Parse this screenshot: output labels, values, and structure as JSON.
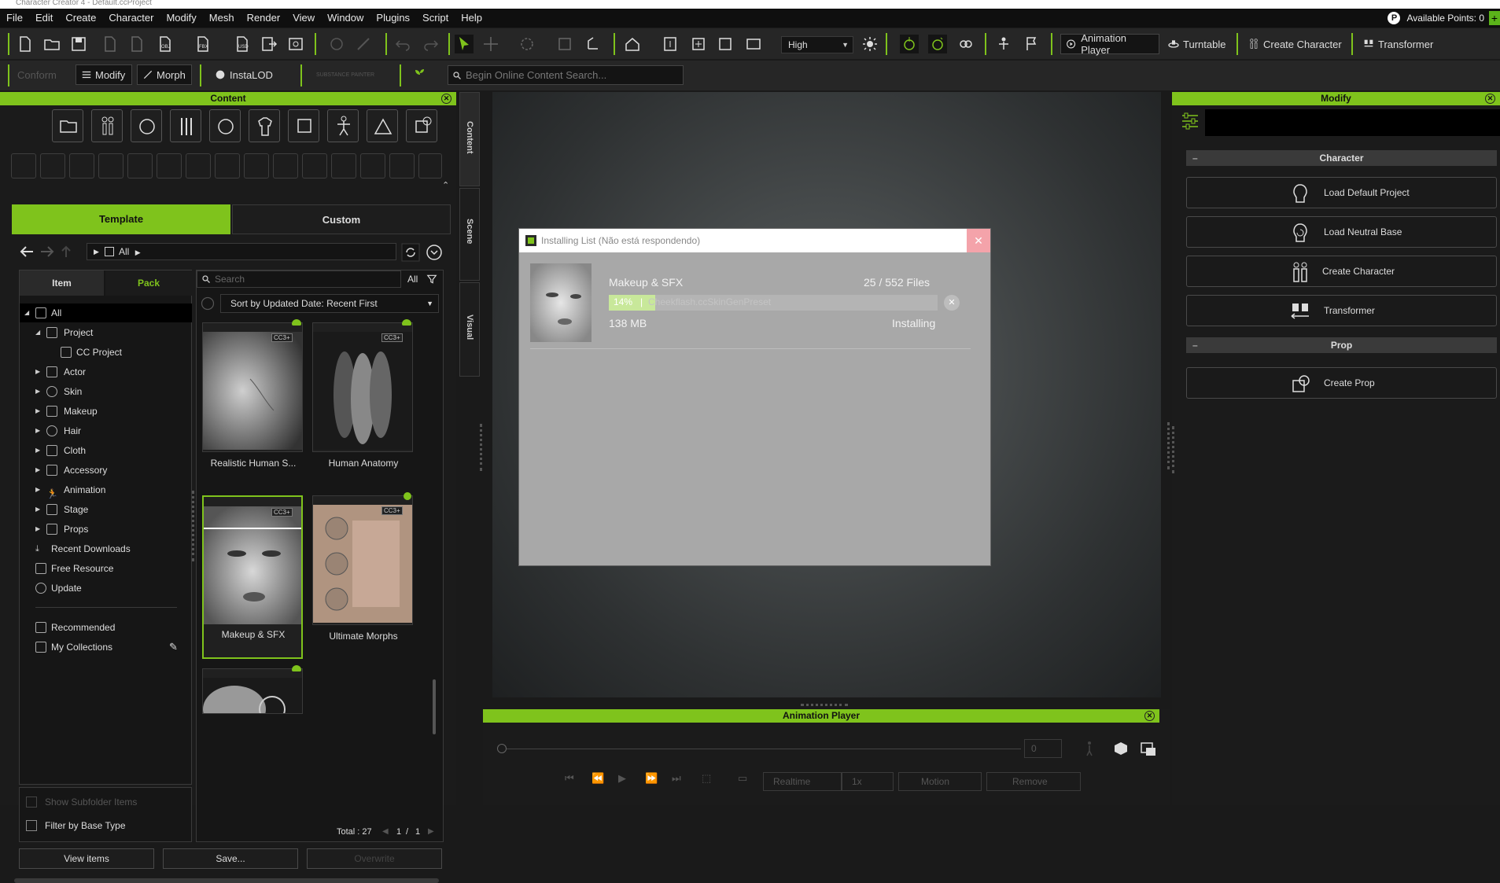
{
  "window": {
    "title": "Character Creator 4 - Default.ccProject"
  },
  "menu": [
    "File",
    "Edit",
    "Create",
    "Character",
    "Modify",
    "Mesh",
    "Render",
    "View",
    "Window",
    "Plugins",
    "Script",
    "Help"
  ],
  "points": {
    "icon": "P",
    "label": "Available Points: 0",
    "plus": "+"
  },
  "toolbar": {
    "quality": "High",
    "animation_player": "Animation Player",
    "turntable": "Turntable",
    "create_character": "Create Character",
    "transformer": "Transformer",
    "conform": "Conform",
    "modify": "Modify",
    "morph": "Morph",
    "instalod": "InstaLOD",
    "substance": "SUBSTANCE PAINTER",
    "search_placeholder": "Begin Online Content Search..."
  },
  "content_panel": {
    "title": "Content",
    "tabs": {
      "template": "Template",
      "custom": "Custom"
    },
    "path": "All",
    "subtabs": {
      "item": "Item",
      "pack": "Pack"
    },
    "search_placeholder": "Search",
    "filter_all": "All",
    "sort": "Sort by Updated Date: Recent First",
    "tree": [
      {
        "label": "All"
      },
      {
        "label": "Project"
      },
      {
        "label": "CC Project"
      },
      {
        "label": "Actor"
      },
      {
        "label": "Skin"
      },
      {
        "label": "Makeup"
      },
      {
        "label": "Hair"
      },
      {
        "label": "Cloth"
      },
      {
        "label": "Accessory"
      },
      {
        "label": "Animation"
      },
      {
        "label": "Stage"
      },
      {
        "label": "Props"
      },
      {
        "label": "Recent Downloads"
      },
      {
        "label": "Free Resource"
      },
      {
        "label": "Update"
      },
      {
        "label": "Recommended"
      },
      {
        "label": "My Collections"
      }
    ],
    "packs": [
      {
        "label": "Realistic Human S..."
      },
      {
        "label": "Human Anatomy"
      },
      {
        "label": "Makeup & SFX"
      },
      {
        "label": "Ultimate Morphs"
      }
    ],
    "badge": "CC3+",
    "total_label": "Total : 27",
    "page": "1",
    "page_sep": "/",
    "page_total": "1",
    "show_subfolder": "Show Subfolder Items",
    "filter_base": "Filter by Base Type",
    "btn_view": "View items",
    "btn_save": "Save...",
    "btn_overwrite": "Overwrite"
  },
  "side_tabs": [
    "Content",
    "Scene",
    "Visual"
  ],
  "dialog": {
    "title": "Installing List (Não está respondendo)",
    "close": "✕",
    "item_name": "Makeup & SFX",
    "files": "25 / 552 Files",
    "progress_label": "14%",
    "progress_fraction": 0.14,
    "file_label": "Cheekflash.ccSkinGenPreset",
    "size": "138 MB",
    "status": "Installing",
    "cancel": "✕"
  },
  "modify_panel": {
    "title": "Modify",
    "character_section": "Character",
    "prop_section": "Prop",
    "collapse": "–",
    "buttons": {
      "load_default": "Load Default Project",
      "load_neutral": "Load Neutral Base",
      "create_character": "Create Character",
      "transformer": "Transformer",
      "create_prop": "Create Prop"
    }
  },
  "anim_panel": {
    "title": "Animation Player",
    "frame": "0",
    "realtime": "Realtime",
    "speed": "1x",
    "motion": "Motion",
    "remove": "Remove"
  },
  "colors": {
    "accent": "#7fc31c",
    "bg": "#1b1b1b",
    "dialog_bg": "#a8a8a8"
  }
}
